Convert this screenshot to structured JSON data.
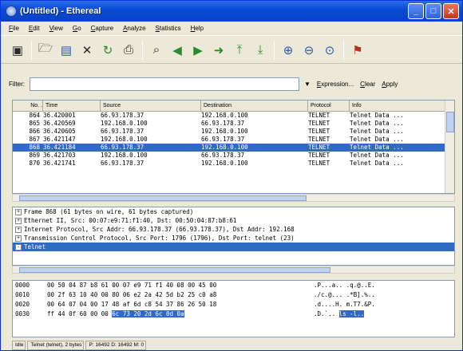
{
  "window": {
    "title": "(Untitled) - Ethereal"
  },
  "menu": [
    "File",
    "Edit",
    "View",
    "Go",
    "Capture",
    "Analyze",
    "Statistics",
    "Help"
  ],
  "toolbar": {
    "icons": [
      "interface-list-icon",
      "open-folder-icon",
      "save-icon",
      "close-file-icon",
      "reload-icon",
      "print-icon",
      "find-packet-icon",
      "go-back-icon",
      "go-forward-icon",
      "go-to-packet-icon",
      "go-first-icon",
      "go-last-icon",
      "zoom-in-icon",
      "zoom-out-icon",
      "zoom-normal-icon",
      "help-icon"
    ]
  },
  "filter": {
    "label": "Filter:",
    "value": "",
    "expression_label": "Expression...",
    "clear_label": "Clear",
    "apply_label": "Apply"
  },
  "packet_list": {
    "columns": [
      "No. .",
      "Time",
      "Source",
      "Destination",
      "Protocol",
      "Info"
    ],
    "rows": [
      {
        "no": "864",
        "time": "36.420001",
        "src": "66.93.178.37",
        "dst": "192.168.0.100",
        "proto": "TELNET",
        "info": "Telnet Data ...",
        "selected": false
      },
      {
        "no": "865",
        "time": "36.420569",
        "src": "192.168.0.100",
        "dst": "66.93.178.37",
        "proto": "TELNET",
        "info": "Telnet Data ...",
        "selected": false
      },
      {
        "no": "866",
        "time": "36.420605",
        "src": "66.93.178.37",
        "dst": "192.168.0.100",
        "proto": "TELNET",
        "info": "Telnet Data ...",
        "selected": false
      },
      {
        "no": "867",
        "time": "36.421147",
        "src": "192.168.0.100",
        "dst": "66.93.178.37",
        "proto": "TELNET",
        "info": "Telnet Data ...",
        "selected": false
      },
      {
        "no": "868",
        "time": "36.421184",
        "src": "66.93.178.37",
        "dst": "192.168.0.100",
        "proto": "TELNET",
        "info": "Telnet Data ...",
        "selected": true
      },
      {
        "no": "869",
        "time": "36.421703",
        "src": "192.168.0.100",
        "dst": "66.93.178.37",
        "proto": "TELNET",
        "info": "Telnet Data ...",
        "selected": false
      },
      {
        "no": "870",
        "time": "36.421741",
        "src": "66.93.178.37",
        "dst": "192.168.0.100",
        "proto": "TELNET",
        "info": "Telnet Data ...",
        "selected": false
      }
    ]
  },
  "details": [
    {
      "expander": "+",
      "text": "Frame 868 (61 bytes on wire, 61 bytes captured)",
      "selected": false
    },
    {
      "expander": "+",
      "text": "Ethernet II, Src: 00:07:e9:71:f1:40, Dst: 00:50:04:87:b8:61",
      "selected": false
    },
    {
      "expander": "+",
      "text": "Internet Protocol, Src Addr: 66.93.178.37 (66.93.178.37), Dst Addr: 192.168",
      "selected": false
    },
    {
      "expander": "+",
      "text": "Transmission Control Protocol, Src Port: 1796 (1796), Dst Port: telnet (23)",
      "selected": false
    },
    {
      "expander": "-",
      "text": "Telnet",
      "selected": true
    }
  ],
  "hex_dump": [
    {
      "offset": "0000",
      "pre": "00 50 04 87 b8 61 00 07  e9 71 f1 40 08 00 45 00",
      "hl": "",
      "post": "",
      "ascii_pre": ".P...a.. .q.@..E.",
      "ascii_hl": ""
    },
    {
      "offset": "0010",
      "pre": "00 2f 63 10 40 00 80 06  e2 2a 42 5d b2 25 c0 a8",
      "hl": "",
      "post": "",
      "ascii_pre": "./c.@... .*B].%..",
      "ascii_hl": ""
    },
    {
      "offset": "0020",
      "pre": "00 64 07 04 00 17 48 af  6d c8 54 37 86 26 50 18",
      "hl": "",
      "post": "",
      "ascii_pre": ".d....H. m.T7.&P.",
      "ascii_hl": ""
    },
    {
      "offset": "0030",
      "pre": "ff 44 0f 60 00 00 ",
      "hl": "6c 73 20 2d 6c 0d 0a",
      "post": "",
      "ascii_pre": ".D.`.. ",
      "ascii_hl": "ls -l.."
    }
  ],
  "status": {
    "segments": [
      "Idle",
      "Telnet (telnet), 2 bytes",
      "P: 16492 D: 16492 M: 0"
    ]
  }
}
